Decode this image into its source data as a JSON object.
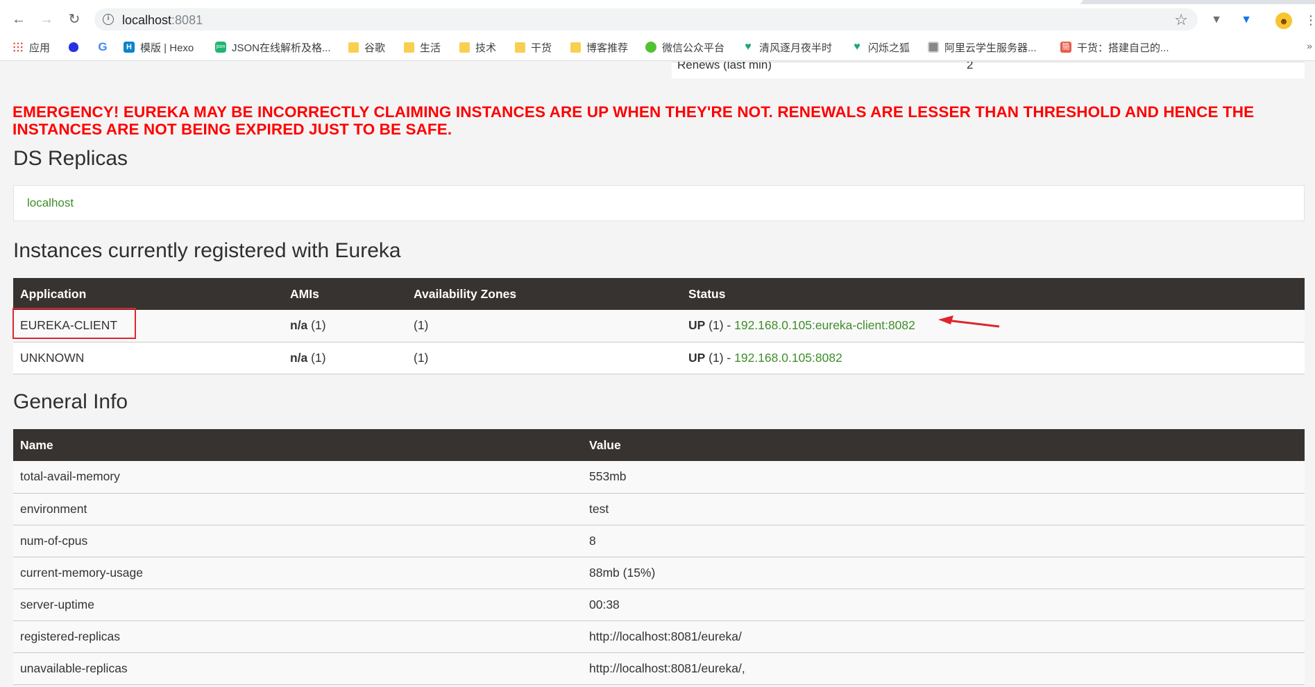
{
  "browser": {
    "url_host": "localhost",
    "url_port": ":8081",
    "icons": {
      "back": "back-arrow-icon",
      "forward": "forward-arrow-icon",
      "reload": "reload-icon",
      "info": "info-icon",
      "star": "bookmark-star-icon",
      "menu": "more-menu-icon"
    }
  },
  "bookmarks": [
    {
      "label": "应用",
      "icon": "apps-grid-icon"
    },
    {
      "label": "",
      "icon": "baidu-paw-icon"
    },
    {
      "label": "",
      "icon": "google-g-icon"
    },
    {
      "label": "模版 | Hexo",
      "icon": "hexo-icon"
    },
    {
      "label": "JSON在线解析及格...",
      "icon": "json-icon"
    },
    {
      "label": "谷歌",
      "icon": "folder-icon"
    },
    {
      "label": "生活",
      "icon": "folder-icon"
    },
    {
      "label": "技术",
      "icon": "folder-icon"
    },
    {
      "label": "干货",
      "icon": "folder-icon"
    },
    {
      "label": "博客推荐",
      "icon": "folder-icon"
    },
    {
      "label": "微信公众平台",
      "icon": "wechat-icon"
    },
    {
      "label": "清风逐月夜半时",
      "icon": "fox-icon"
    },
    {
      "label": "闪烁之狐",
      "icon": "fox-icon"
    },
    {
      "label": "阿里云学生服务器...",
      "icon": "aliyun-icon"
    },
    {
      "label": "干货：搭建自己的...",
      "icon": "jianshu-icon"
    }
  ],
  "bookmarks_more": "»",
  "top_table": {
    "key": "Renews (last min)",
    "value": "2"
  },
  "emergency_text": "EMERGENCY! EUREKA MAY BE INCORRECTLY CLAIMING INSTANCES ARE UP WHEN THEY'RE NOT. RENEWALS ARE LESSER THAN THRESHOLD AND HENCE THE INSTANCES ARE NOT BEING EXPIRED JUST TO BE SAFE.",
  "emergency_color": "#ff0000",
  "replicas": {
    "title": "DS Replicas",
    "link": "localhost"
  },
  "instances": {
    "title": "Instances currently registered with Eureka",
    "columns": [
      "Application",
      "AMIs",
      "Availability Zones",
      "Status"
    ],
    "rows": [
      {
        "application": "EUREKA-CLIENT",
        "amis_value": "n/a",
        "amis_count": " (1)",
        "zones": "(1)",
        "status_prefix": "UP",
        "status_count": " (1) - ",
        "status_link": "192.168.0.105:eureka-client:8082"
      },
      {
        "application": "UNKNOWN",
        "amis_value": "n/a",
        "amis_count": " (1)",
        "zones": "(1)",
        "status_prefix": "UP",
        "status_count": " (1) - ",
        "status_link": "192.168.0.105:8082"
      }
    ]
  },
  "general": {
    "title": "General Info",
    "columns": [
      "Name",
      "Value"
    ],
    "rows": [
      {
        "name": "total-avail-memory",
        "value": "553mb"
      },
      {
        "name": "environment",
        "value": "test"
      },
      {
        "name": "num-of-cpus",
        "value": "8"
      },
      {
        "name": "current-memory-usage",
        "value": "88mb (15%)"
      },
      {
        "name": "server-uptime",
        "value": "00:38"
      },
      {
        "name": "registered-replicas",
        "value": "http://localhost:8081/eureka/"
      },
      {
        "name": "unavailable-replicas",
        "value": "http://localhost:8081/eureka/,"
      }
    ]
  },
  "colors": {
    "header_bg": "#373330",
    "link_green": "#3f8d2b",
    "highlight_red": "#e0242c"
  }
}
